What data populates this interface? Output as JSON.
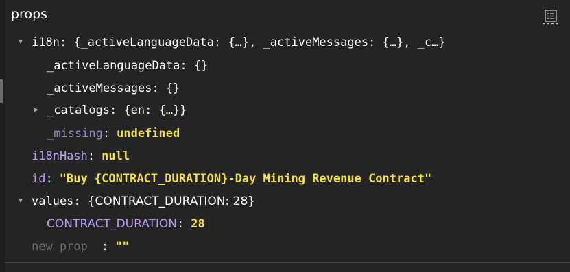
{
  "header": {
    "title": "props",
    "icon": "list-view-icon"
  },
  "rows": {
    "i18n": {
      "key": "i18n",
      "colon": ":",
      "summary": "{_activeLanguageData: {…}, _activeMessages: {…}, _c…}",
      "expanded": true
    },
    "activeLanguageData": {
      "key": "_activeLanguageData",
      "colon": ":",
      "value": "{}"
    },
    "activeMessages": {
      "key": "_activeMessages",
      "colon": ":",
      "value": "{}"
    },
    "catalogs": {
      "key": "_catalogs",
      "colon": ":",
      "value": "{en: {…}}",
      "expanded": false
    },
    "missing": {
      "key": "_missing",
      "colon": ":",
      "value": "undefined"
    },
    "i18nHash": {
      "key": "i18nHash",
      "colon": ":",
      "value": "null"
    },
    "id": {
      "key": "id",
      "colon": ":",
      "value": "\"Buy {CONTRACT_DURATION}-Day Mining Revenue Contract\""
    },
    "values": {
      "key": "values",
      "colon": ":",
      "summary": "{CONTRACT_DURATION: 28}",
      "expanded": true
    },
    "contractDuration": {
      "key": "CONTRACT_DURATION",
      "colon": ":",
      "value": "28"
    },
    "newProp": {
      "key_placeholder": "new prop",
      "colon": ":",
      "value": "\"\""
    }
  }
}
